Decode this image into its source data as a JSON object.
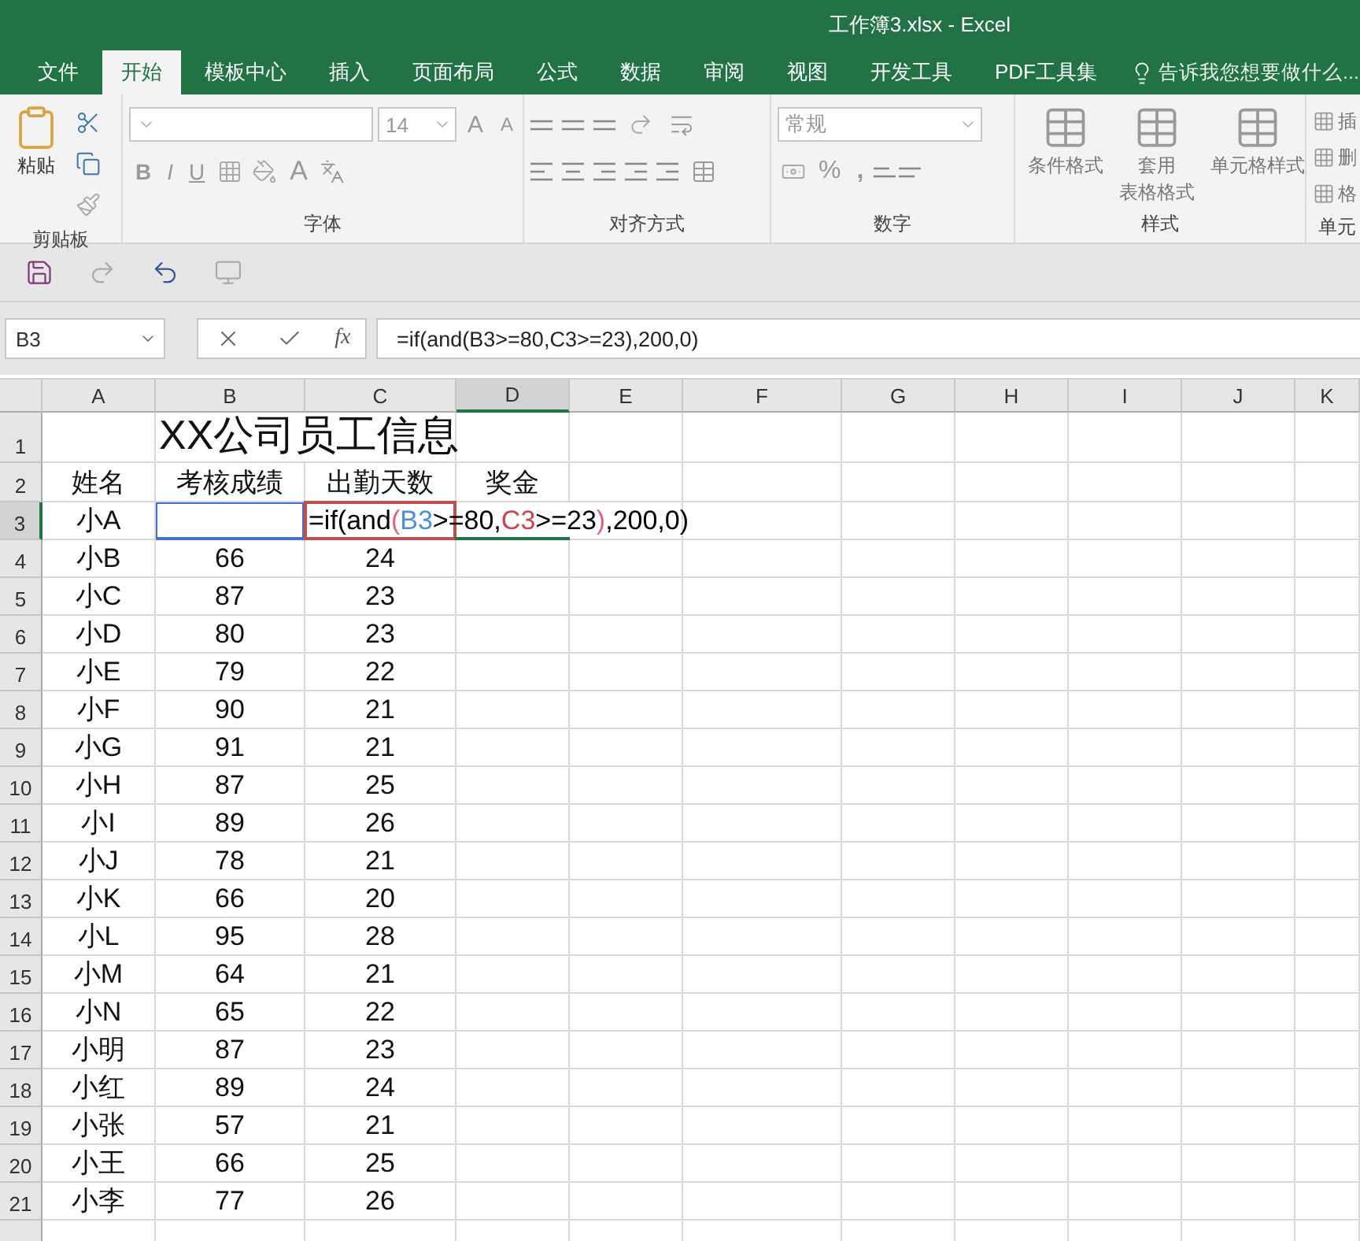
{
  "window": {
    "title": "工作簿3.xlsx - Excel"
  },
  "ribbon_tabs": [
    {
      "label": "文件",
      "selected": false
    },
    {
      "label": "开始",
      "selected": true
    },
    {
      "label": "模板中心",
      "selected": false
    },
    {
      "label": "插入",
      "selected": false
    },
    {
      "label": "页面布局",
      "selected": false
    },
    {
      "label": "公式",
      "selected": false
    },
    {
      "label": "数据",
      "selected": false
    },
    {
      "label": "审阅",
      "selected": false
    },
    {
      "label": "视图",
      "selected": false
    },
    {
      "label": "开发工具",
      "selected": false
    },
    {
      "label": "PDF工具集",
      "selected": false
    }
  ],
  "tell_me": {
    "text": "告诉我您想要做什么..."
  },
  "ribbon_groups": [
    {
      "kind": "clipboard",
      "label": "剪贴板",
      "paste": "粘贴"
    },
    {
      "kind": "font",
      "label": "字体",
      "font_size": "14",
      "grow": "A",
      "shrink": "A",
      "bold": "B",
      "italic": "I",
      "underline": "U",
      "font_color": "A"
    },
    {
      "kind": "alignment",
      "label": "对齐方式"
    },
    {
      "kind": "number",
      "label": "数字",
      "format": "常规",
      "percent": "%",
      "comma": ","
    },
    {
      "kind": "styles",
      "label": "样式",
      "buttons": [
        [
          "条件格式"
        ],
        [
          "套用",
          "表格格式"
        ],
        [
          "单元格样式"
        ]
      ]
    },
    {
      "kind": "cells",
      "label": "单元",
      "buttons": [
        "插",
        "删",
        "格"
      ]
    }
  ],
  "formula_bar": {
    "name_box": "B3",
    "fx": "fx",
    "formula": "=if(and(B3>=80,C3>=23),200,0)"
  },
  "columns": [
    {
      "label": "A",
      "selected": false
    },
    {
      "label": "B",
      "selected": false
    },
    {
      "label": "C",
      "selected": false
    },
    {
      "label": "D",
      "selected": true
    },
    {
      "label": "E",
      "selected": false
    },
    {
      "label": "F",
      "selected": false
    },
    {
      "label": "G",
      "selected": false
    },
    {
      "label": "H",
      "selected": false
    },
    {
      "label": "I",
      "selected": false
    },
    {
      "label": "J",
      "selected": false
    },
    {
      "label": "K",
      "selected": false
    }
  ],
  "rows": [
    {
      "label": "1",
      "selected": false,
      "cells": [
        null,
        {
          "text": "XX公司员工信息",
          "kind": "title"
        }
      ]
    },
    {
      "label": "2",
      "selected": false,
      "cells": [
        {
          "text": "姓名"
        },
        {
          "text": "考核成绩"
        },
        {
          "text": "出勤天数"
        },
        {
          "text": "奖金"
        }
      ]
    },
    {
      "label": "3",
      "selected": true,
      "cells": [
        {
          "text": "小A"
        },
        {
          "color": "#4472c4"
        },
        {
          "color": "#c0504d",
          "kind": "formula",
          "segments": [
            {
              "text": "=if(and",
              "color": "#000000"
            },
            {
              "text": "(",
              "color": "#e0607e"
            },
            {
              "text": "B3",
              "color": "#4a8fd8"
            },
            {
              "text": ">=80,",
              "color": "#000000"
            },
            {
              "text": "C3",
              "color": "#d0404e"
            },
            {
              "text": ">=23",
              "color": "#000000"
            },
            {
              "text": ")",
              "color": "#e0607e"
            },
            {
              "text": ",200,0)",
              "color": "#000000"
            }
          ]
        },
        {
          "color": "#217346"
        }
      ]
    },
    {
      "label": "4",
      "selected": false,
      "cells": [
        {
          "text": "小B"
        },
        {
          "text": "66"
        },
        {
          "text": "24"
        }
      ]
    },
    {
      "label": "5",
      "selected": false,
      "cells": [
        {
          "text": "小C"
        },
        {
          "text": "87"
        },
        {
          "text": "23"
        }
      ]
    },
    {
      "label": "6",
      "selected": false,
      "cells": [
        {
          "text": "小D"
        },
        {
          "text": "80"
        },
        {
          "text": "23"
        }
      ]
    },
    {
      "label": "7",
      "selected": false,
      "cells": [
        {
          "text": "小E"
        },
        {
          "text": "79"
        },
        {
          "text": "22"
        }
      ]
    },
    {
      "label": "8",
      "selected": false,
      "cells": [
        {
          "text": "小F"
        },
        {
          "text": "90"
        },
        {
          "text": "21"
        }
      ]
    },
    {
      "label": "9",
      "selected": false,
      "cells": [
        {
          "text": "小G"
        },
        {
          "text": "91"
        },
        {
          "text": "21"
        }
      ]
    },
    {
      "label": "10",
      "selected": false,
      "cells": [
        {
          "text": "小H"
        },
        {
          "text": "87"
        },
        {
          "text": "25"
        }
      ]
    },
    {
      "label": "11",
      "selected": false,
      "cells": [
        {
          "text": "小I"
        },
        {
          "text": "89"
        },
        {
          "text": "26"
        }
      ]
    },
    {
      "label": "12",
      "selected": false,
      "cells": [
        {
          "text": "小J"
        },
        {
          "text": "78"
        },
        {
          "text": "21"
        }
      ]
    },
    {
      "label": "13",
      "selected": false,
      "cells": [
        {
          "text": "小K"
        },
        {
          "text": "66"
        },
        {
          "text": "20"
        }
      ]
    },
    {
      "label": "14",
      "selected": false,
      "cells": [
        {
          "text": "小L"
        },
        {
          "text": "95"
        },
        {
          "text": "28"
        }
      ]
    },
    {
      "label": "15",
      "selected": false,
      "cells": [
        {
          "text": "小M"
        },
        {
          "text": "64"
        },
        {
          "text": "21"
        }
      ]
    },
    {
      "label": "16",
      "selected": false,
      "cells": [
        {
          "text": "小N"
        },
        {
          "text": "65"
        },
        {
          "text": "22"
        }
      ]
    },
    {
      "label": "17",
      "selected": false,
      "cells": [
        {
          "text": "小明"
        },
        {
          "text": "87"
        },
        {
          "text": "23"
        }
      ]
    },
    {
      "label": "18",
      "selected": false,
      "cells": [
        {
          "text": "小红"
        },
        {
          "text": "89"
        },
        {
          "text": "24"
        }
      ]
    },
    {
      "label": "19",
      "selected": false,
      "cells": [
        {
          "text": "小张"
        },
        {
          "text": "57"
        },
        {
          "text": "21"
        }
      ]
    },
    {
      "label": "20",
      "selected": false,
      "cells": [
        {
          "text": "小王"
        },
        {
          "text": "66"
        },
        {
          "text": "25"
        }
      ]
    },
    {
      "label": "21",
      "selected": false,
      "cells": [
        {
          "text": "小李"
        },
        {
          "text": "77"
        },
        {
          "text": "26"
        }
      ]
    }
  ]
}
